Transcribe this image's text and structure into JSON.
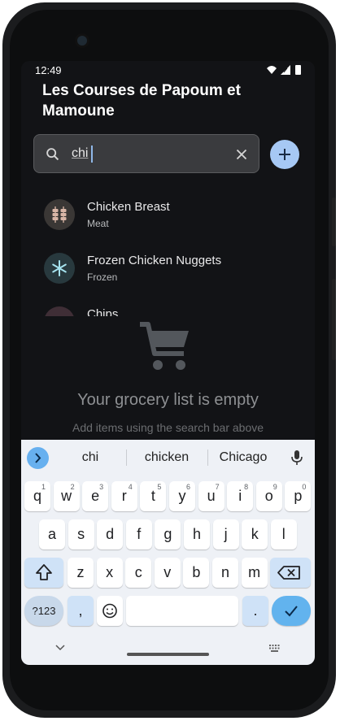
{
  "status": {
    "time": "12:49"
  },
  "app": {
    "title": "Les Courses de Papoum et Mamoune"
  },
  "search": {
    "value": "chi"
  },
  "suggestions": [
    {
      "name": "Chicken Breast",
      "category": "Meat",
      "icon": "skewer-icon"
    },
    {
      "name": "Frozen Chicken Nuggets",
      "category": "Frozen",
      "icon": "snowflake-icon"
    },
    {
      "name": "Chips",
      "category": "",
      "icon": "chips-icon"
    }
  ],
  "empty_state": {
    "title": "Your grocery list is empty",
    "subtitle": "Add items using the search bar above"
  },
  "keyboard": {
    "suggestions": [
      "chi",
      "chicken",
      "Chicago"
    ],
    "row1": [
      {
        "k": "q",
        "h": "1"
      },
      {
        "k": "w",
        "h": "2"
      },
      {
        "k": "e",
        "h": "3"
      },
      {
        "k": "r",
        "h": "4"
      },
      {
        "k": "t",
        "h": "5"
      },
      {
        "k": "y",
        "h": "6"
      },
      {
        "k": "u",
        "h": "7"
      },
      {
        "k": "i",
        "h": "8"
      },
      {
        "k": "o",
        "h": "9"
      },
      {
        "k": "p",
        "h": "0"
      }
    ],
    "row2": [
      "a",
      "s",
      "d",
      "f",
      "g",
      "h",
      "j",
      "k",
      "l"
    ],
    "row3": [
      "z",
      "x",
      "c",
      "v",
      "b",
      "n",
      "m"
    ],
    "symbols_label": "?123",
    "comma_label": ",",
    "period_label": "."
  },
  "colors": {
    "accent": "#a6c8f4",
    "background": "#121316",
    "keyboard": "#eef1f6",
    "enter": "#62b3ee"
  }
}
